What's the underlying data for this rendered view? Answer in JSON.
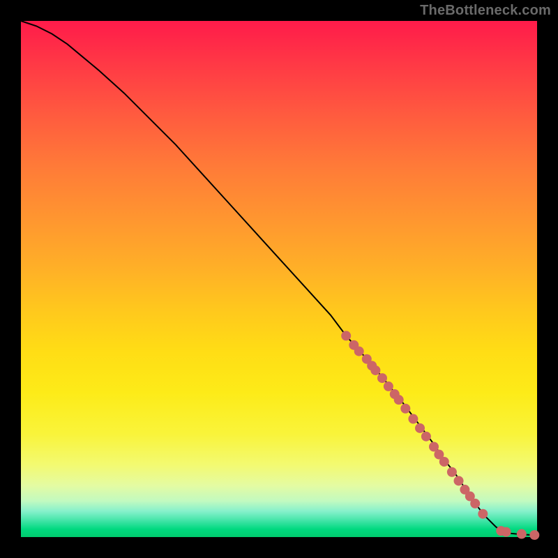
{
  "attribution": "TheBottleneck.com",
  "chart_data": {
    "type": "line",
    "title": "",
    "xlabel": "",
    "ylabel": "",
    "xlim": [
      0,
      100
    ],
    "ylim": [
      0,
      100
    ],
    "series": [
      {
        "name": "curve",
        "x": [
          0,
          3,
          6,
          9,
          12,
          15,
          20,
          25,
          30,
          35,
          40,
          45,
          50,
          55,
          60,
          63,
          67,
          70,
          74,
          77,
          80,
          82,
          84,
          86,
          87,
          88,
          90,
          92,
          93,
          95,
          97,
          99,
          100
        ],
        "y": [
          100,
          99,
          97.5,
          95.5,
          93,
          90.5,
          86,
          81,
          76,
          70.5,
          65,
          59.5,
          54,
          48.5,
          43,
          39,
          34.5,
          31,
          26,
          22,
          18,
          15,
          12.5,
          9.5,
          8,
          6.5,
          4,
          2,
          1.2,
          0.7,
          0.5,
          0.4,
          0.4
        ]
      },
      {
        "name": "scatter-points",
        "x": [
          63,
          64.5,
          65.5,
          67,
          68,
          68.7,
          70,
          71.2,
          72.4,
          73.2,
          74.5,
          76,
          77.3,
          78.5,
          80,
          81,
          82,
          83.5,
          84.8,
          86,
          87,
          88,
          89.5,
          93,
          94,
          97,
          99.5
        ],
        "y": [
          39,
          37.2,
          36,
          34.5,
          33.2,
          32.3,
          30.8,
          29.2,
          27.7,
          26.6,
          24.9,
          22.9,
          21.1,
          19.5,
          17.5,
          16,
          14.6,
          12.6,
          10.9,
          9.2,
          7.9,
          6.5,
          4.5,
          1.2,
          1,
          0.6,
          0.4
        ]
      }
    ],
    "colors": {
      "curve": "#000000",
      "points": "#cc6666"
    }
  }
}
